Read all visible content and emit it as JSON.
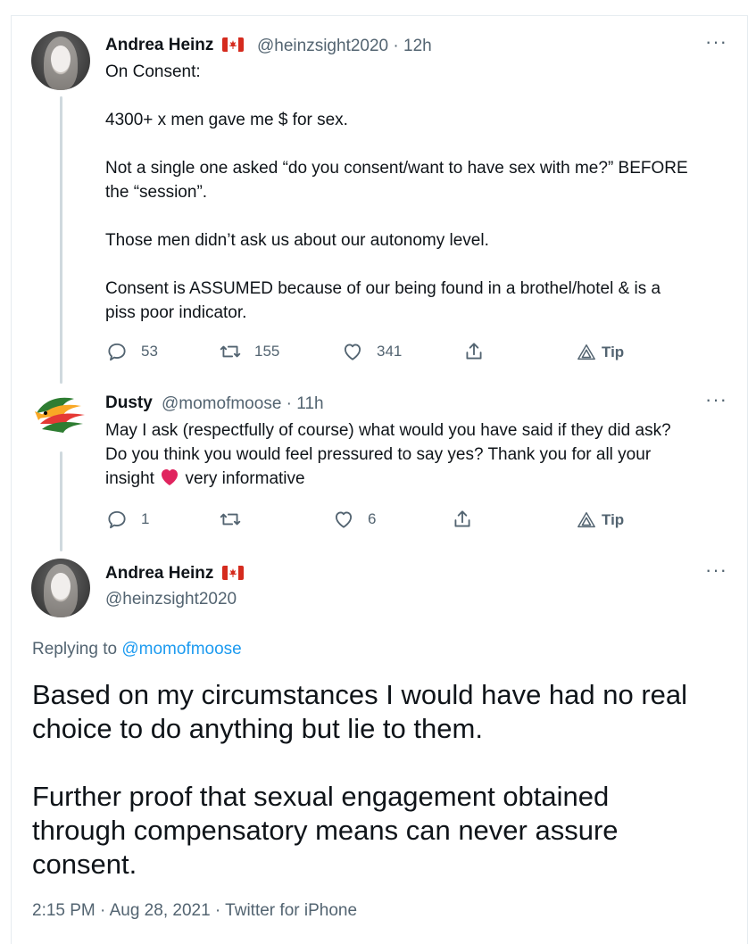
{
  "tweet1": {
    "name": "Andrea Heinz",
    "handle": "@heinzsight2020",
    "time": "12h",
    "lines": [
      "On Consent:",
      "",
      "4300+ x men gave me $ for sex.",
      "",
      "Not a single one asked “do you consent/want to have sex with me?” BEFORE",
      "the “session”.",
      "",
      "Those men didn’t ask us about our autonomy level.",
      "",
      "Consent is ASSUMED because of our being found in a brothel/hotel & is a",
      "piss poor indicator."
    ],
    "replies": "53",
    "retweets": "155",
    "likes": "341",
    "tip_label": "Tip"
  },
  "tweet2": {
    "name": "Dusty",
    "handle": "@momofmoose",
    "time": "11h",
    "line1": "May I ask (respectfully of course) what would you have said if they did ask?",
    "line2": "Do you think you would feel pressured to say yes? Thank you for all your",
    "line3a": "insight",
    "line3b": "very informative",
    "replies": "1",
    "retweets": "",
    "likes": "6",
    "tip_label": "Tip"
  },
  "tweet3": {
    "name": "Andrea Heinz",
    "handle": "@heinzsight2020",
    "replying_prefix": "Replying to",
    "replying_handle": "@momofmoose",
    "big_lines": [
      "Based on my circumstances I would have had no real",
      "choice to do anything but lie to them.",
      "",
      "Further proof that sexual engagement obtained",
      "through compensatory means can never assure",
      "consent."
    ],
    "timestamp": "2:15 PM · Aug 28, 2021 · Twitter for iPhone"
  },
  "icons": {
    "more": "more-icon",
    "reply": "reply-icon",
    "retweet": "retweet-icon",
    "like": "heart-icon",
    "share": "share-icon",
    "tip": "tip-icon",
    "flag": "canada-flag-icon",
    "emoji": "red-heart-icon"
  },
  "colors": {
    "link": "#1d9bf0",
    "secondary": "#536471",
    "heart": "#e0245e",
    "flag": "#d52b1e"
  }
}
